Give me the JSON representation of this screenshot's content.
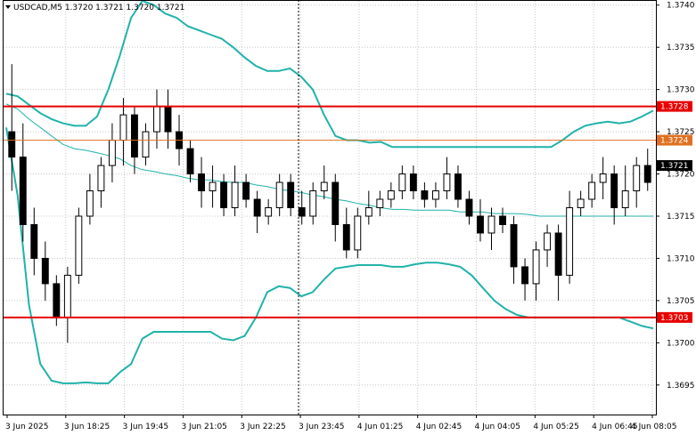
{
  "chart_data": {
    "type": "candlestick",
    "title": "USDCAD,M5  1.3720 1.3721 1.3720 1.3721",
    "price_ylim": [
      1.36915,
      1.37405
    ],
    "x_ticks": [
      "3 Jun 2025",
      "3 Jun 18:25",
      "3 Jun 19:45",
      "3 Jun 21:05",
      "3 Jun 22:25",
      "3 Jun 23:45",
      "4 Jun 01:25",
      "4 Jun 02:45",
      "4 Jun 04:05",
      "4 Jun 05:25",
      "4 Jun 06:45",
      "4 Jun 08:05"
    ],
    "y_ticks": [
      "1.3740",
      "1.3735",
      "1.3730",
      "1.3725",
      "1.3720",
      "1.3715",
      "1.3710",
      "1.3705",
      "1.3700",
      "1.3695"
    ],
    "levels": [
      {
        "price": 1.3728,
        "label": "1.3728",
        "color": "#e60000",
        "style": "solid"
      },
      {
        "price": 1.3724,
        "label": "1.3724",
        "color": "#e07020",
        "style": "thin"
      },
      {
        "price": 1.3703,
        "label": "1.3703",
        "color": "#e60000",
        "style": "solid"
      }
    ],
    "current_price": {
      "price": 1.3721,
      "label": "1.3721"
    },
    "colors": {
      "candle": "#000000",
      "bands": "#20b2aa",
      "grid": "#c8c8c8",
      "axis": "#000000"
    },
    "candles": [
      [
        1.3725,
        1.3733,
        1.3718,
        1.3722
      ],
      [
        1.3722,
        1.3726,
        1.3712,
        1.3714
      ],
      [
        1.3714,
        1.3716,
        1.3708,
        1.371
      ],
      [
        1.371,
        1.3712,
        1.3705,
        1.3707
      ],
      [
        1.3707,
        1.3708,
        1.3702,
        1.3703
      ],
      [
        1.3703,
        1.3709,
        1.37,
        1.3708
      ],
      [
        1.3708,
        1.3716,
        1.3707,
        1.3715
      ],
      [
        1.3715,
        1.372,
        1.3714,
        1.3718
      ],
      [
        1.3718,
        1.3722,
        1.3716,
        1.3721
      ],
      [
        1.3721,
        1.3726,
        1.3719,
        1.3724
      ],
      [
        1.3724,
        1.3729,
        1.3721,
        1.3727
      ],
      [
        1.3727,
        1.3728,
        1.372,
        1.3722
      ],
      [
        1.3722,
        1.3726,
        1.3721,
        1.3725
      ],
      [
        1.3725,
        1.373,
        1.3723,
        1.3728
      ],
      [
        1.3728,
        1.373,
        1.3723,
        1.3725
      ],
      [
        1.3725,
        1.3727,
        1.3721,
        1.3723
      ],
      [
        1.3723,
        1.3724,
        1.3719,
        1.372
      ],
      [
        1.372,
        1.3722,
        1.3716,
        1.3718
      ],
      [
        1.3718,
        1.3721,
        1.3716,
        1.3719
      ],
      [
        1.3719,
        1.372,
        1.3715,
        1.3716
      ],
      [
        1.3716,
        1.3721,
        1.3715,
        1.3719
      ],
      [
        1.3719,
        1.372,
        1.3716,
        1.3717
      ],
      [
        1.3717,
        1.3718,
        1.3713,
        1.3715
      ],
      [
        1.3715,
        1.3717,
        1.3714,
        1.3716
      ],
      [
        1.3716,
        1.372,
        1.3715,
        1.3719
      ],
      [
        1.3719,
        1.372,
        1.3715,
        1.3716
      ],
      [
        1.3716,
        1.3718,
        1.3714,
        1.3715
      ],
      [
        1.3715,
        1.3719,
        1.3714,
        1.3718
      ],
      [
        1.3718,
        1.3721,
        1.3717,
        1.3719
      ],
      [
        1.3719,
        1.372,
        1.3712,
        1.3714
      ],
      [
        1.3714,
        1.3716,
        1.371,
        1.3711
      ],
      [
        1.3711,
        1.3716,
        1.371,
        1.3715
      ],
      [
        1.3715,
        1.3718,
        1.3714,
        1.3716
      ],
      [
        1.3716,
        1.3718,
        1.3715,
        1.3717
      ],
      [
        1.3717,
        1.3719,
        1.3716,
        1.3718
      ],
      [
        1.3718,
        1.3721,
        1.3717,
        1.372
      ],
      [
        1.372,
        1.3721,
        1.3717,
        1.3718
      ],
      [
        1.3718,
        1.3719,
        1.3716,
        1.3717
      ],
      [
        1.3717,
        1.3719,
        1.3716,
        1.3718
      ],
      [
        1.3718,
        1.3722,
        1.3717,
        1.372
      ],
      [
        1.372,
        1.3721,
        1.3716,
        1.3717
      ],
      [
        1.3717,
        1.3718,
        1.3714,
        1.3715
      ],
      [
        1.3715,
        1.3717,
        1.3712,
        1.3713
      ],
      [
        1.3713,
        1.3716,
        1.3711,
        1.3715
      ],
      [
        1.3715,
        1.3716,
        1.3713,
        1.3714
      ],
      [
        1.3714,
        1.3715,
        1.3707,
        1.3709
      ],
      [
        1.3709,
        1.371,
        1.3705,
        1.3707
      ],
      [
        1.3707,
        1.3712,
        1.3705,
        1.3711
      ],
      [
        1.3711,
        1.3714,
        1.3709,
        1.3713
      ],
      [
        1.3713,
        1.3714,
        1.3705,
        1.3708
      ],
      [
        1.3708,
        1.3718,
        1.3707,
        1.3716
      ],
      [
        1.3716,
        1.3718,
        1.3715,
        1.3717
      ],
      [
        1.3717,
        1.372,
        1.3716,
        1.3719
      ],
      [
        1.3719,
        1.3722,
        1.3717,
        1.372
      ],
      [
        1.372,
        1.3721,
        1.3714,
        1.3716
      ],
      [
        1.3716,
        1.3721,
        1.3715,
        1.3718
      ],
      [
        1.3718,
        1.3722,
        1.3716,
        1.3721
      ],
      [
        1.3721,
        1.3723,
        1.3718,
        1.3719
      ]
    ],
    "upper_band": [
      1.37295,
      1.37292,
      1.37282,
      1.37272,
      1.37265,
      1.3726,
      1.37257,
      1.37257,
      1.37268,
      1.373,
      1.3734,
      1.37385,
      1.37405,
      1.374,
      1.3739,
      1.37385,
      1.37375,
      1.3737,
      1.37365,
      1.3736,
      1.3735,
      1.37338,
      1.37328,
      1.37322,
      1.37322,
      1.37325,
      1.37315,
      1.373,
      1.3727,
      1.37245,
      1.3724,
      1.3724,
      1.37237,
      1.37238,
      1.37232,
      1.37232,
      1.37232,
      1.37232,
      1.37232,
      1.37232,
      1.37232,
      1.37232,
      1.37232,
      1.37232,
      1.37232,
      1.37232,
      1.37232,
      1.37232,
      1.37232,
      1.3724,
      1.3725,
      1.37257,
      1.3726,
      1.37262,
      1.3726,
      1.37262,
      1.37268,
      1.37275
    ],
    "middle_band": [
      1.37283,
      1.37277,
      1.37265,
      1.37255,
      1.37245,
      1.37235,
      1.3723,
      1.37228,
      1.37225,
      1.37222,
      1.37218,
      1.3721,
      1.37205,
      1.37203,
      1.372,
      1.37198,
      1.37195,
      1.37193,
      1.37193,
      1.37191,
      1.3719,
      1.3719,
      1.37187,
      1.37185,
      1.37182,
      1.3718,
      1.37178,
      1.37175,
      1.37173,
      1.3717,
      1.37168,
      1.37165,
      1.37163,
      1.3716,
      1.37158,
      1.37158,
      1.37157,
      1.37157,
      1.37157,
      1.37157,
      1.37155,
      1.37155,
      1.37155,
      1.37153,
      1.37153,
      1.37153,
      1.37152,
      1.3715,
      1.3715,
      1.3715,
      1.3715,
      1.3715,
      1.3715,
      1.3715,
      1.3715,
      1.3715,
      1.3715,
      1.3715
    ],
    "lower_band": [
      1.37255,
      1.37175,
      1.37045,
      1.36975,
      1.36955,
      1.36952,
      1.36952,
      1.36953,
      1.36952,
      1.36952,
      1.36965,
      1.36975,
      1.37005,
      1.37013,
      1.37013,
      1.37013,
      1.37013,
      1.37013,
      1.37013,
      1.37005,
      1.37003,
      1.37008,
      1.3703,
      1.3706,
      1.37067,
      1.37065,
      1.37055,
      1.3706,
      1.37075,
      1.37088,
      1.3709,
      1.37092,
      1.37092,
      1.37092,
      1.3709,
      1.3709,
      1.37093,
      1.37095,
      1.37095,
      1.37093,
      1.3709,
      1.3708,
      1.37065,
      1.3705,
      1.3704,
      1.37033,
      1.3703,
      1.3703,
      1.3703,
      1.3703,
      1.3703,
      1.3703,
      1.3703,
      1.3703,
      1.3703,
      1.37025,
      1.3702,
      1.37017
    ]
  }
}
